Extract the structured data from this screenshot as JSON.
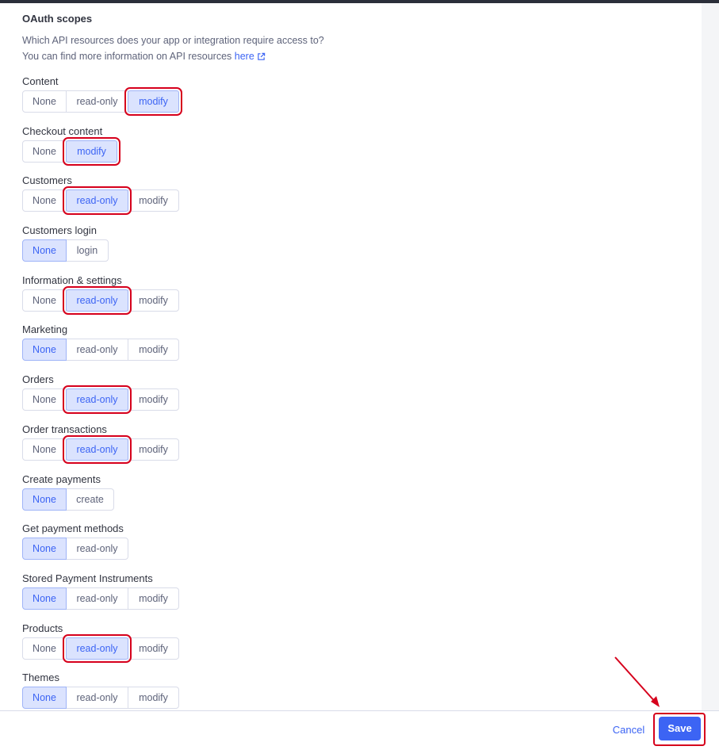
{
  "section": {
    "title": "OAuth scopes",
    "description_line1": "Which API resources does your app or integration require access to?",
    "description_line2_prefix": "You can find more information on API resources ",
    "link_text": "here"
  },
  "scopes": [
    {
      "label": "Content",
      "options": [
        "None",
        "read-only",
        "modify"
      ],
      "selected": "modify"
    },
    {
      "label": "Checkout content",
      "options": [
        "None",
        "modify"
      ],
      "selected": "modify"
    },
    {
      "label": "Customers",
      "options": [
        "None",
        "read-only",
        "modify"
      ],
      "selected": "read-only"
    },
    {
      "label": "Customers login",
      "options": [
        "None",
        "login"
      ],
      "selected": "None"
    },
    {
      "label": "Information & settings",
      "options": [
        "None",
        "read-only",
        "modify"
      ],
      "selected": "read-only"
    },
    {
      "label": "Marketing",
      "options": [
        "None",
        "read-only",
        "modify"
      ],
      "selected": "None"
    },
    {
      "label": "Orders",
      "options": [
        "None",
        "read-only",
        "modify"
      ],
      "selected": "read-only"
    },
    {
      "label": "Order transactions",
      "options": [
        "None",
        "read-only",
        "modify"
      ],
      "selected": "read-only"
    },
    {
      "label": "Create payments",
      "options": [
        "None",
        "create"
      ],
      "selected": "None"
    },
    {
      "label": "Get payment methods",
      "options": [
        "None",
        "read-only"
      ],
      "selected": "None"
    },
    {
      "label": "Stored Payment Instruments",
      "options": [
        "None",
        "read-only",
        "modify"
      ],
      "selected": "None"
    },
    {
      "label": "Products",
      "options": [
        "None",
        "read-only",
        "modify"
      ],
      "selected": "read-only"
    },
    {
      "label": "Themes",
      "options": [
        "None",
        "read-only",
        "modify"
      ],
      "selected": "None"
    }
  ],
  "footer": {
    "cancel_label": "Cancel",
    "save_label": "Save"
  },
  "colors": {
    "accent": "#3c64f4",
    "selected_bg": "#dbe3fe",
    "annotation_red": "#d6001c"
  },
  "icons": {
    "external_link": "external-link-icon"
  }
}
